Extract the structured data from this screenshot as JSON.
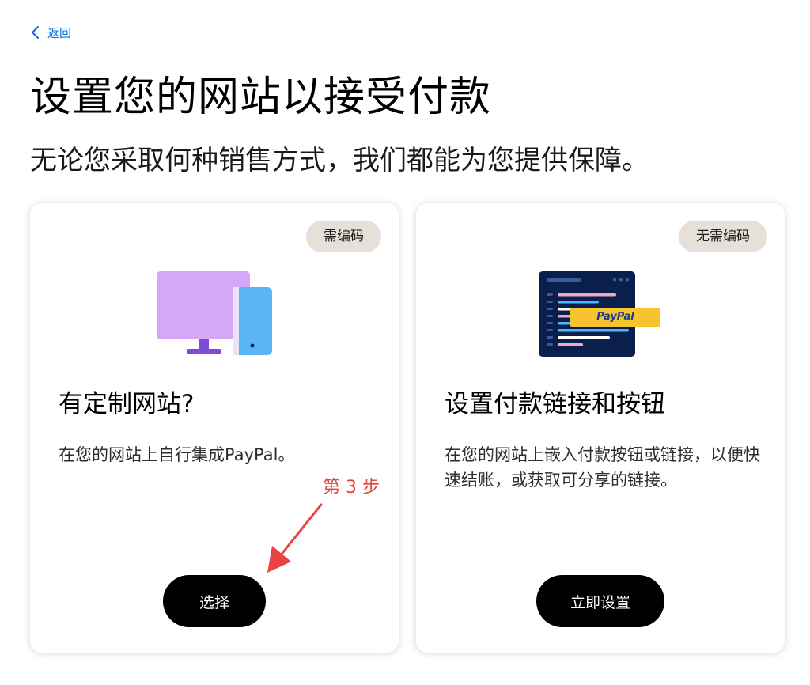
{
  "nav": {
    "back_label": "返回"
  },
  "header": {
    "title": "设置您的网站以接受付款",
    "subtitle": "无论您采取何种销售方式，我们都能为您提供保障。"
  },
  "cards": [
    {
      "badge": "需编码",
      "title": "有定制网站?",
      "description": "在您的网站上自行集成PayPal。",
      "button_label": "选择",
      "icon": "desktop-mobile-icon"
    },
    {
      "badge": "无需编码",
      "title": "设置付款链接和按钮",
      "description": "在您的网站上嵌入付款按钮或链接，以便快速结账，或获取可分享的链接。",
      "button_label": "立即设置",
      "icon": "code-editor-paypal-icon",
      "icon_text": "PayPal"
    }
  ],
  "annotation": {
    "step_label": "第 3 步"
  },
  "colors": {
    "link": "#0070e0",
    "badge_bg": "#e6e0d9",
    "button_bg": "#000000",
    "annotation": "#e8433f",
    "editor_bg": "#0b1f4d",
    "paypal_yellow": "#f7c32e"
  }
}
